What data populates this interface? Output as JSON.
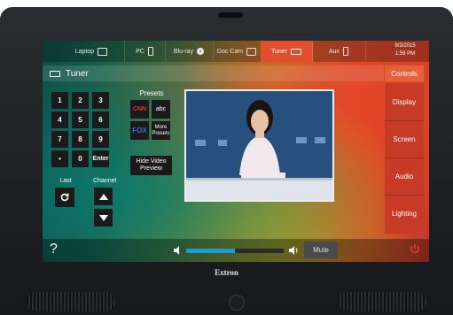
{
  "sources": [
    {
      "label": "Laptop",
      "icon": "laptop-icon"
    },
    {
      "label": "PC",
      "icon": "pc-icon"
    },
    {
      "label": "Blu-ray",
      "icon": "disc-icon"
    },
    {
      "label": "Doc Cam",
      "icon": "doc-cam-icon"
    },
    {
      "label": "Tuner",
      "icon": "tuner-icon",
      "active": true
    },
    {
      "label": "Aux",
      "icon": "aux-icon"
    }
  ],
  "clock": {
    "date": "9/3/2015",
    "time": "1:59 PM"
  },
  "title": "Tuner",
  "controls_label": "Controls",
  "nav": [
    "Display",
    "Screen",
    "Audio",
    "Lighting"
  ],
  "keypad": [
    "1",
    "2",
    "3",
    "4",
    "5",
    "6",
    "7",
    "8",
    "9",
    "•",
    "0",
    "Enter"
  ],
  "labels": {
    "last": "Last",
    "channel": "Channel",
    "presets": "Presets"
  },
  "presets": [
    "CNN",
    "abc",
    "FOX",
    "More Presets"
  ],
  "hide_video": "Hide Video Preview",
  "bottom": {
    "help": "?",
    "mute": "Mute",
    "volume": 0.5
  },
  "brand": "Extron",
  "colors": {
    "active_tab": "#e0502e",
    "nav_panel": "#c63a26",
    "volume_fill": "#1f9bd1"
  }
}
